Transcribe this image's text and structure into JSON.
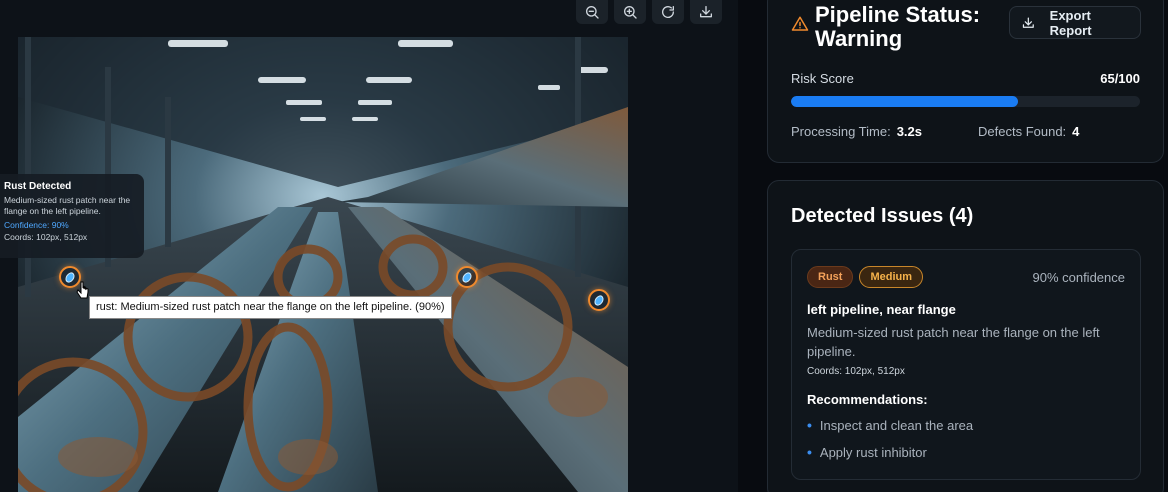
{
  "toolbar": {
    "buttons": [
      {
        "name": "zoom-out",
        "icon": "zoom-out-icon"
      },
      {
        "name": "zoom-in",
        "icon": "zoom-in-icon"
      },
      {
        "name": "reset",
        "icon": "rotate-icon"
      },
      {
        "name": "download",
        "icon": "download-icon"
      }
    ]
  },
  "overlay": {
    "card": {
      "title": "Rust Detected",
      "description": "Medium-sized rust patch near the flange on the left pipeline.",
      "confidence": "Confidence: 90%",
      "coords": "Coords: 102px, 512px"
    },
    "tooltip": "rust: Medium-sized rust patch near the flange on the left pipeline. (90%)"
  },
  "status": {
    "title": "Pipeline Status: Warning",
    "export_label": "Export Report",
    "risk_label": "Risk Score",
    "risk_value": "65/100",
    "risk_fraction": 0.65,
    "processing_label": "Processing Time:",
    "processing_value": "3.2s",
    "defects_label": "Defects Found:",
    "defects_value": "4"
  },
  "issues": {
    "title": "Detected Issues (4)",
    "items": [
      {
        "type": "Rust",
        "severity": "Medium",
        "confidence": "90% confidence",
        "location": "left pipeline, near flange",
        "description": "Medium-sized rust patch near the flange on the left pipeline.",
        "coords": "Coords: 102px, 512px",
        "recommendations_title": "Recommendations:",
        "recommendations": [
          "Inspect and clean the area",
          "Apply rust inhibitor"
        ]
      }
    ]
  },
  "colors": {
    "accent": "#1a7cf3",
    "warning": "#f08a2d"
  }
}
